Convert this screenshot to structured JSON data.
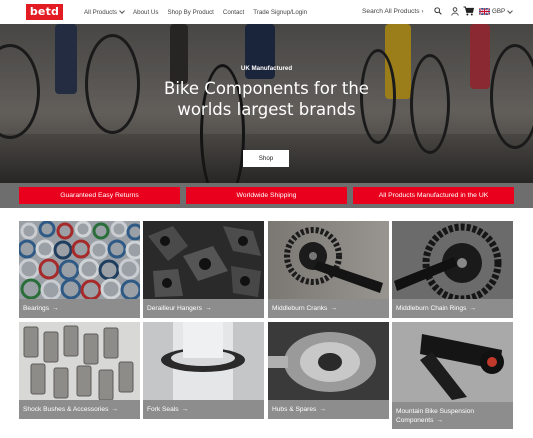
{
  "header": {
    "logo": "betd",
    "nav": [
      {
        "label": "All Products",
        "dropdown": true
      },
      {
        "label": "About Us",
        "dropdown": false
      },
      {
        "label": "Shop By Product",
        "dropdown": false
      },
      {
        "label": "Contact",
        "dropdown": false
      },
      {
        "label": "Trade Signup/Login",
        "dropdown": false
      }
    ],
    "search_label": "Search All Products",
    "search_chevron": "›",
    "currency": "GBP",
    "icons": [
      "search-icon",
      "user-icon",
      "cart-icon",
      "uk-flag-icon"
    ]
  },
  "hero": {
    "kicker": "UK Manufactured",
    "title_line1": "Bike Components for the",
    "title_line2": "worlds largest brands",
    "button": "Shop"
  },
  "usps": [
    "Guaranteed Easy Returns",
    "Worldwide Shipping",
    "All Products Manufactured in the UK"
  ],
  "categories": [
    {
      "label": "Bearings",
      "arrow": "→"
    },
    {
      "label": "Derailleur Hangers",
      "arrow": "→"
    },
    {
      "label": "Middleburn Cranks",
      "arrow": "→"
    },
    {
      "label": "Middleburn Chain Rings",
      "arrow": "→"
    },
    {
      "label": "Shock Bushes & Accessories",
      "arrow": "→"
    },
    {
      "label": "Fork Seals",
      "arrow": "→"
    },
    {
      "label": "Hubs & Spares",
      "arrow": "→"
    },
    {
      "label": "Mountain Bike Suspension",
      "label2": "Components",
      "arrow": "→"
    }
  ],
  "colors": {
    "brand_red": "#e31b23",
    "usp_red": "#e8001c",
    "caption_grey": "#8d8d8d"
  }
}
